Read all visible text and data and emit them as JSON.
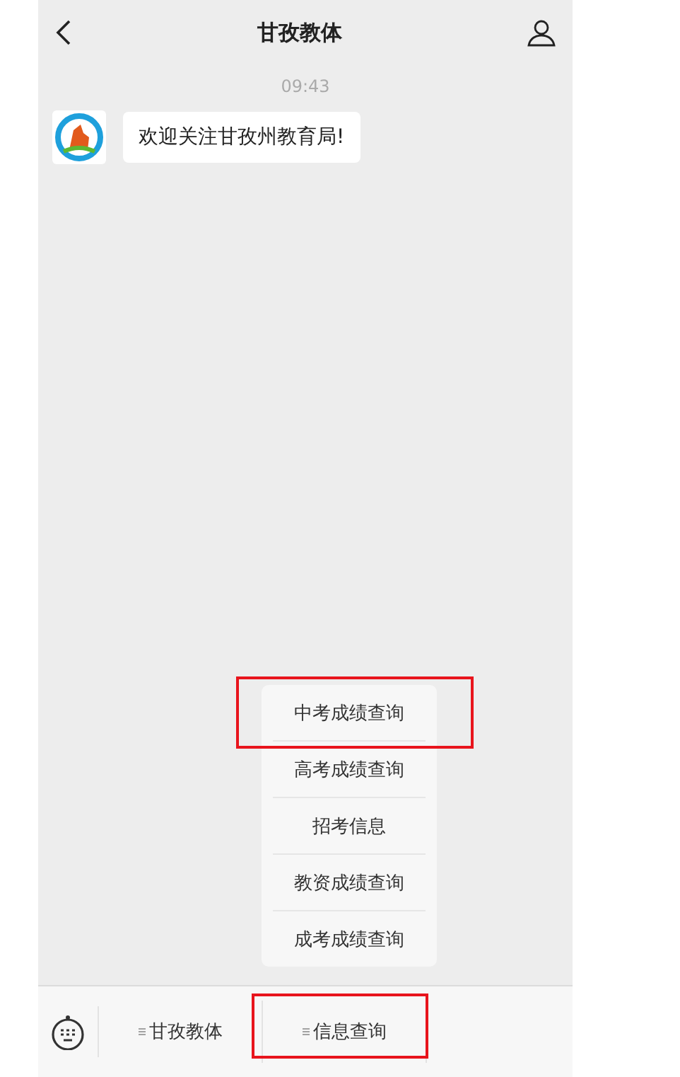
{
  "header": {
    "title": "甘孜教体"
  },
  "chat": {
    "time": "09:43",
    "messages": [
      {
        "text": "欢迎关注甘孜州教育局!"
      }
    ]
  },
  "popup_menu": {
    "items": [
      {
        "label": "中考成绩查询",
        "highlighted": true
      },
      {
        "label": "高考成绩查询",
        "highlighted": false
      },
      {
        "label": "招考信息",
        "highlighted": false
      },
      {
        "label": "教资成绩查询",
        "highlighted": false
      },
      {
        "label": "成考成绩查询",
        "highlighted": false
      }
    ]
  },
  "bottom_menu": {
    "items": [
      {
        "label": "甘孜教体",
        "highlighted": false
      },
      {
        "label": "信息查询",
        "highlighted": true
      }
    ]
  }
}
